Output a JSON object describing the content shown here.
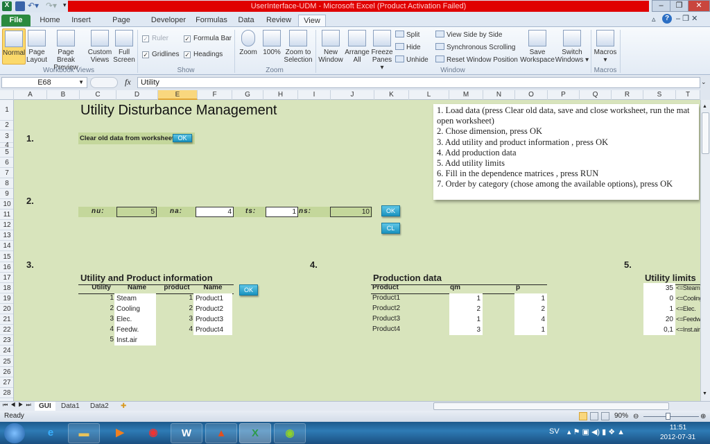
{
  "window": {
    "title": "UserInterface-UDM  -  Microsoft Excel (Product Activation Failed)",
    "minimize": "–",
    "restore": "❐",
    "close": "✕"
  },
  "ribbon_tabs": [
    {
      "label": "File"
    },
    {
      "label": "Home"
    },
    {
      "label": "Insert"
    },
    {
      "label": "Page Layout"
    },
    {
      "label": "Developer"
    },
    {
      "label": "Formulas"
    },
    {
      "label": "Data"
    },
    {
      "label": "Review"
    },
    {
      "label": "View"
    }
  ],
  "ribbon": {
    "workbook_views": {
      "label": "Workbook Views",
      "items": [
        "Normal",
        "Page Layout",
        "Page Break Preview",
        "Custom Views",
        "Full Screen"
      ]
    },
    "show": {
      "label": "Show",
      "ruler": {
        "label": "Ruler",
        "checked": true,
        "disabled": true
      },
      "formula_bar": {
        "label": "Formula Bar",
        "checked": true
      },
      "gridlines": {
        "label": "Gridlines",
        "checked": true
      },
      "headings": {
        "label": "Headings",
        "checked": true
      }
    },
    "zoom": {
      "label": "Zoom",
      "items": [
        "Zoom",
        "100%",
        "Zoom to Selection"
      ]
    },
    "window": {
      "label": "Window",
      "new_window": "New Window",
      "arrange_all": "Arrange All",
      "freeze_panes": "Freeze Panes",
      "split": "Split",
      "hide": "Hide",
      "unhide": "Unhide",
      "view_side": "View Side by Side",
      "sync_scroll": "Synchronous Scrolling",
      "reset_pos": "Reset Window Position",
      "save_ws": "Save Workspace",
      "switch": "Switch Windows"
    },
    "macros": {
      "label": "Macros",
      "button": "Macros"
    }
  },
  "formula_bar": {
    "name_box": "E68",
    "fx": "fx",
    "value": "Utility"
  },
  "columns": [
    "A",
    "B",
    "C",
    "D",
    "E",
    "F",
    "G",
    "H",
    "I",
    "J",
    "K",
    "L",
    "M",
    "N",
    "O",
    "P",
    "Q",
    "R",
    "S",
    "T"
  ],
  "selected_column": "E",
  "rows": [
    "1",
    "2",
    "3",
    "4",
    "5",
    "6",
    "7",
    "8",
    "9",
    "10",
    "11",
    "12",
    "13",
    "14",
    "15",
    "16",
    "17",
    "18",
    "19",
    "20",
    "21",
    "22",
    "23",
    "24",
    "25",
    "26",
    "27",
    "28"
  ],
  "sheet": {
    "title": "Utility Disturbance Management",
    "step1": "1.",
    "clear_label": "Clear old data from worksheet",
    "ok": "OK",
    "step2": "2.",
    "nu_label": "nu:",
    "nu": "5",
    "na_label": "na:",
    "na": "4",
    "ts_label": "ts:",
    "ts": "1",
    "ns_label": "ns:",
    "ns": "10",
    "cl": "CL",
    "step3": "3.",
    "step4": "4.",
    "step5": "5.",
    "upi_title": "Utility and Product information",
    "upi_headers": [
      "Utility",
      "Name",
      "product",
      "Name"
    ],
    "utilities": [
      {
        "n": "1",
        "name": "Steam"
      },
      {
        "n": "2",
        "name": "Cooling"
      },
      {
        "n": "3",
        "name": "Elec."
      },
      {
        "n": "4",
        "name": "Feedw."
      },
      {
        "n": "5",
        "name": "Inst.air"
      }
    ],
    "products": [
      {
        "n": "1",
        "name": "Product1"
      },
      {
        "n": "2",
        "name": "Product2"
      },
      {
        "n": "3",
        "name": "Product3"
      },
      {
        "n": "4",
        "name": "Product4"
      }
    ],
    "prod_title": "Production data",
    "prod_headers": [
      "Product",
      "qm",
      "p"
    ],
    "prod_rows": [
      {
        "product": "Product1",
        "qm": "1",
        "p": "1"
      },
      {
        "product": "Product2",
        "qm": "2",
        "p": "2"
      },
      {
        "product": "Product3",
        "qm": "1",
        "p": "4"
      },
      {
        "product": "Product4",
        "qm": "3",
        "p": "1"
      }
    ],
    "limits_title": "Utility limits",
    "limits": [
      {
        "v": "35",
        "label": "<=Steam"
      },
      {
        "v": "0",
        "label": "<=Cooling"
      },
      {
        "v": "1",
        "label": "<=Elec."
      },
      {
        "v": "20",
        "label": "<=Feedw."
      },
      {
        "v": "0,1",
        "label": "<=Inst.air"
      }
    ],
    "instructions": [
      "1. Load data (press Clear old data, save and close worksheet, run the mat",
      "open worksheet)",
      "2. Chose dimension, press OK",
      "3. Add utility and product information , press OK",
      "4. Add production data",
      "5. Add utility limits",
      "6. Fill in the  dependence matrices , press RUN",
      "7. Order by category (chose among the  available options), press OK"
    ]
  },
  "sheet_tabs": [
    {
      "label": "GUI",
      "active": true
    },
    {
      "label": "Data1"
    },
    {
      "label": "Data2"
    }
  ],
  "status": {
    "ready": "Ready",
    "zoom": "90%",
    "zoom_level": 90
  },
  "taskbar": {
    "lang": "SV",
    "time": "11:51",
    "date": "2012-07-31"
  },
  "colors": {
    "sheet_bg": "#d8e4bc",
    "title_red": "#e00000",
    "ok_button": "#1a93bf",
    "file_tab": "#2b8a3e"
  }
}
